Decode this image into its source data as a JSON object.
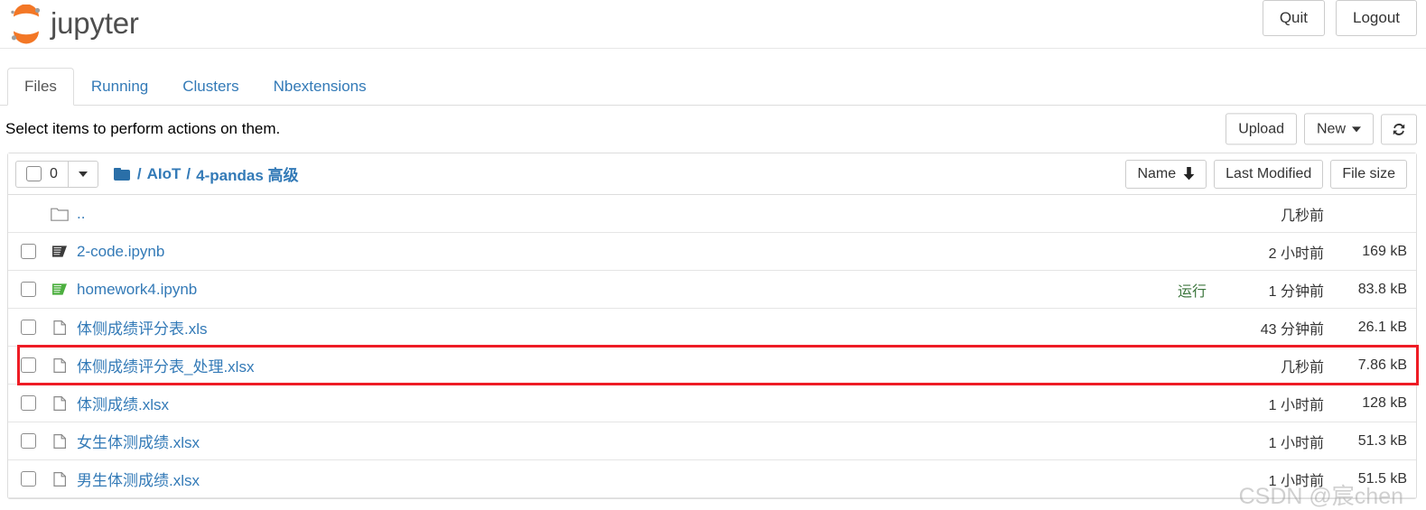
{
  "header": {
    "brand": "jupyter",
    "logo_icon": "jupyter-logo-icon",
    "quit_label": "Quit",
    "logout_label": "Logout"
  },
  "tabs": [
    {
      "label": "Files",
      "active": true
    },
    {
      "label": "Running",
      "active": false
    },
    {
      "label": "Clusters",
      "active": false
    },
    {
      "label": "Nbextensions",
      "active": false
    }
  ],
  "toolbar": {
    "note": "Select items to perform actions on them.",
    "upload_label": "Upload",
    "new_label": "New",
    "refresh_icon": "refresh-icon"
  },
  "list_header": {
    "selected_count": "0",
    "select_all_icon": "checkbox-icon",
    "dropdown_icon": "chevron-down-icon",
    "root_icon": "folder-icon",
    "breadcrumb": [
      "AIoT",
      "4-pandas 高级"
    ],
    "separator": "/",
    "sort_name": "Name",
    "sort_name_arrow": "↓",
    "sort_modified": "Last Modified",
    "sort_size": "File size"
  },
  "rows": [
    {
      "name": "..",
      "icon": "folder-icon",
      "kind": "folder",
      "checkbox": false,
      "status": "",
      "modified": "几秒前",
      "size": "",
      "highlight": false
    },
    {
      "name": "2-code.ipynb",
      "icon": "notebook-icon",
      "kind": "notebook",
      "checkbox": true,
      "status": "",
      "modified": "2 小时前",
      "size": "169 kB",
      "highlight": false
    },
    {
      "name": "homework4.ipynb",
      "icon": "notebook-running-icon",
      "kind": "notebook-running",
      "checkbox": true,
      "status": "运行",
      "modified": "1 分钟前",
      "size": "83.8 kB",
      "highlight": false
    },
    {
      "name": "体侧成绩评分表.xls",
      "icon": "file-icon",
      "kind": "file",
      "checkbox": true,
      "status": "",
      "modified": "43 分钟前",
      "size": "26.1 kB",
      "highlight": false
    },
    {
      "name": "体侧成绩评分表_处理.xlsx",
      "icon": "file-icon",
      "kind": "file",
      "checkbox": true,
      "status": "",
      "modified": "几秒前",
      "size": "7.86 kB",
      "highlight": true
    },
    {
      "name": "体测成绩.xlsx",
      "icon": "file-icon",
      "kind": "file",
      "checkbox": true,
      "status": "",
      "modified": "1 小时前",
      "size": "128 kB",
      "highlight": false
    },
    {
      "name": "女生体测成绩.xlsx",
      "icon": "file-icon",
      "kind": "file",
      "checkbox": true,
      "status": "",
      "modified": "1 小时前",
      "size": "51.3 kB",
      "highlight": false
    },
    {
      "name": "男生体测成绩.xlsx",
      "icon": "file-icon",
      "kind": "file",
      "checkbox": true,
      "status": "",
      "modified": "1 小时前",
      "size": "51.5 kB",
      "highlight": false
    }
  ],
  "watermark": "CSDN @宸chen",
  "colors": {
    "link": "#337ab7",
    "running": "#3c763d",
    "highlight": "#ee1c25",
    "logo_orange": "#f37726",
    "brand_gray": "#4e4e4e"
  }
}
